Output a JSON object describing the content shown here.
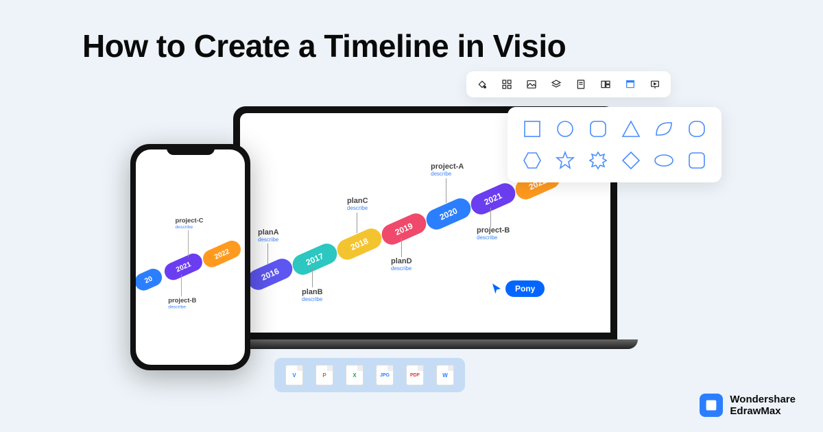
{
  "title": "How to Create a Timeline in Visio",
  "brand": {
    "line1": "Wondershare",
    "line2": "EdrawMax"
  },
  "timeline": {
    "segments": [
      {
        "year": "2016",
        "color": "#5d56f0"
      },
      {
        "year": "2017",
        "color": "#2bc7c0"
      },
      {
        "year": "2018",
        "color": "#f4c430"
      },
      {
        "year": "2019",
        "color": "#ef4a6b"
      },
      {
        "year": "2020",
        "color": "#2b7fff"
      },
      {
        "year": "2021",
        "color": "#6b3df0"
      },
      {
        "year": "2022",
        "color": "#ff9a1f"
      }
    ],
    "callouts": [
      {
        "label": "planA",
        "sub": "describe"
      },
      {
        "label": "planB",
        "sub": "describe"
      },
      {
        "label": "planC",
        "sub": "describe"
      },
      {
        "label": "planD",
        "sub": "describe"
      },
      {
        "label": "project-A",
        "sub": "describe"
      },
      {
        "label": "project-B",
        "sub": "describe"
      },
      {
        "label": "project-C",
        "sub": "describe"
      }
    ]
  },
  "phone_timeline": {
    "segments": [
      {
        "year": "20",
        "color": "#2b7fff"
      },
      {
        "year": "2021",
        "color": "#6b3df0"
      },
      {
        "year": "2022",
        "color": "#ff9a1f"
      }
    ],
    "callouts": [
      {
        "label": "project-C",
        "sub": "describe"
      },
      {
        "label": "project-B",
        "sub": "describe"
      }
    ]
  },
  "cursor_label": "Pony",
  "file_formats": [
    {
      "label": "V",
      "color": "#2b7fff"
    },
    {
      "label": "P",
      "color": "#e05a2b"
    },
    {
      "label": "X",
      "color": "#2aa35a"
    },
    {
      "label": "JPG",
      "color": "#2b7fff"
    },
    {
      "label": "PDF",
      "color": "#d23c3c"
    },
    {
      "label": "W",
      "color": "#2b7fff"
    }
  ],
  "toolbar_icons": [
    "fill-icon",
    "grid-icon",
    "image-icon",
    "layers-icon",
    "page-icon",
    "arrange-icon",
    "theme-icon",
    "present-icon"
  ],
  "shapes": [
    "square",
    "circle",
    "rounded-square",
    "triangle",
    "leaf",
    "rounded-rect",
    "hexagon",
    "star",
    "burst",
    "diamond",
    "ellipse",
    "rounded-square2"
  ]
}
